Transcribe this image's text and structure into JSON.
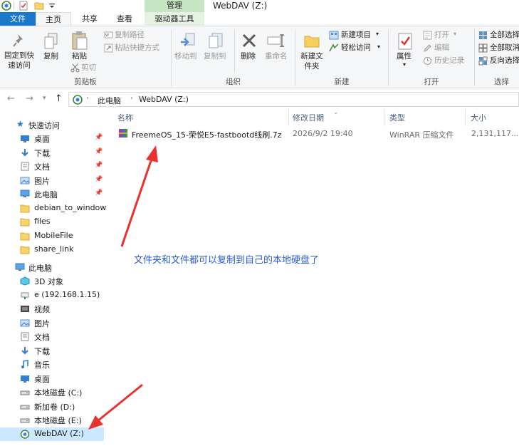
{
  "window": {
    "title": "WebDAV (Z:)",
    "context_tab_header": "管理"
  },
  "tabs": [
    {
      "label": "文件"
    },
    {
      "label": "主页"
    },
    {
      "label": "共享"
    },
    {
      "label": "查看"
    },
    {
      "label": "驱动器工具"
    }
  ],
  "ribbon": {
    "pin_label": "固定到快速访问",
    "copy_label": "复制",
    "paste_label": "粘贴",
    "copy_path_label": "复制路径",
    "paste_shortcut_label": "粘贴快捷方式",
    "cut_label": "剪切",
    "group_clipboard": "剪贴板",
    "move_to_label": "移动到",
    "copy_to_label": "复制到",
    "delete_label": "删除",
    "rename_label": "重命名",
    "group_organize": "组织",
    "new_folder_label": "新建文件夹",
    "new_item_label": "新建项目",
    "easy_access_label": "轻松访问",
    "group_new": "新建",
    "properties_label": "属性",
    "open_label": "打开",
    "edit_label": "编辑",
    "history_label": "历史记录",
    "group_open": "打开",
    "select_all_label": "全部选择",
    "select_none_label": "全部取消",
    "invert_label": "反向选择",
    "group_select": "选择"
  },
  "address": {
    "crumbs": [
      "此电脑",
      "WebDAV (Z:)"
    ]
  },
  "navpane": {
    "quick_access": "快速访问",
    "quick_items": [
      {
        "label": "桌面",
        "pinned": true
      },
      {
        "label": "下载",
        "pinned": true
      },
      {
        "label": "文档",
        "pinned": true
      },
      {
        "label": "图片",
        "pinned": true
      },
      {
        "label": "此电脑",
        "pinned": true
      },
      {
        "label": "debian_to_windows",
        "pinned": false
      },
      {
        "label": "files",
        "pinned": false
      },
      {
        "label": "MobileFile",
        "pinned": false
      },
      {
        "label": "share_link",
        "pinned": false
      }
    ],
    "this_pc": "此电脑",
    "pc_items": [
      {
        "label": "3D 对象"
      },
      {
        "label": "e (192.168.1.15)"
      },
      {
        "label": "视频"
      },
      {
        "label": "图片"
      },
      {
        "label": "文档"
      },
      {
        "label": "下载"
      },
      {
        "label": "音乐"
      },
      {
        "label": "桌面"
      },
      {
        "label": "本地磁盘 (C:)"
      },
      {
        "label": "新加卷 (D:)"
      },
      {
        "label": "本地磁盘 (E:)"
      },
      {
        "label": "WebDAV (Z:)"
      }
    ]
  },
  "columns": {
    "name": "名称",
    "date": "修改日期",
    "type": "类型",
    "size": "大小"
  },
  "files": [
    {
      "name": "FreemeOS_15-荣悦E5-fastbootd线刷.7z",
      "date": "2026/9/2 19:40",
      "type": "WinRAR 压缩文件",
      "size": "2,131,117..."
    }
  ],
  "annotation": "文件夹和文件都可以复制到自己的本地硬盘了",
  "colors": {
    "accent": "#1979ca",
    "annotation": "#2a5bd7",
    "arrow": "#e8322d",
    "selected": "#cce8ff"
  }
}
